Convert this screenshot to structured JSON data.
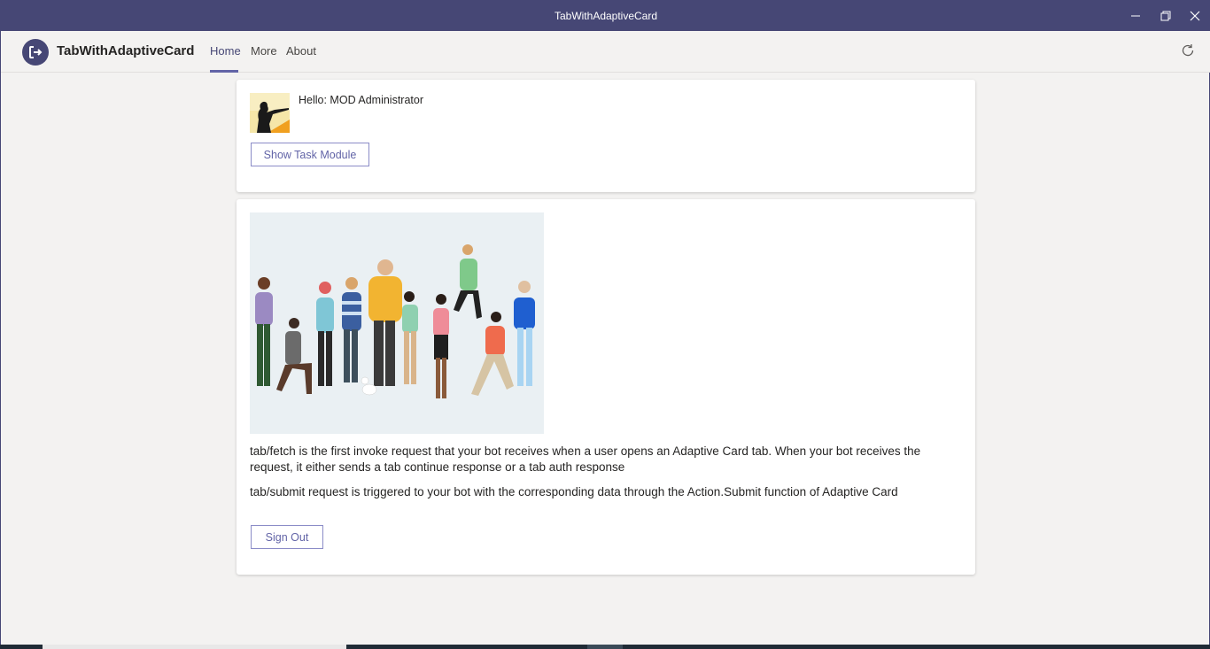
{
  "window": {
    "title": "TabWithAdaptiveCard",
    "controls": {
      "minimize_icon": "minimize-icon",
      "maximize_icon": "restore-icon",
      "close_icon": "close-icon"
    }
  },
  "app": {
    "name": "TabWithAdaptiveCard",
    "logo_icon": "sign-out-arrow-icon",
    "tabs": [
      {
        "label": "Home",
        "active": true
      },
      {
        "label": "More",
        "active": false
      },
      {
        "label": "About",
        "active": false
      }
    ],
    "refresh_icon": "refresh-icon"
  },
  "greeting_card": {
    "hello_text": "Hello: MOD Administrator",
    "show_task_module_label": "Show Task Module"
  },
  "info_card": {
    "paragraph1": "tab/fetch is the first invoke request that your bot receives when a user opens an Adaptive Card tab. When your bot receives the request, it either sends a tab continue response or a tab auth response",
    "paragraph2": "tab/submit request is triggered to your bot with the corresponding data through the Action.Submit function of Adaptive Card",
    "sign_out_label": "Sign Out"
  },
  "colors": {
    "titlebar": "#464775",
    "accent": "#6264a7",
    "background": "#f3f2f1"
  }
}
